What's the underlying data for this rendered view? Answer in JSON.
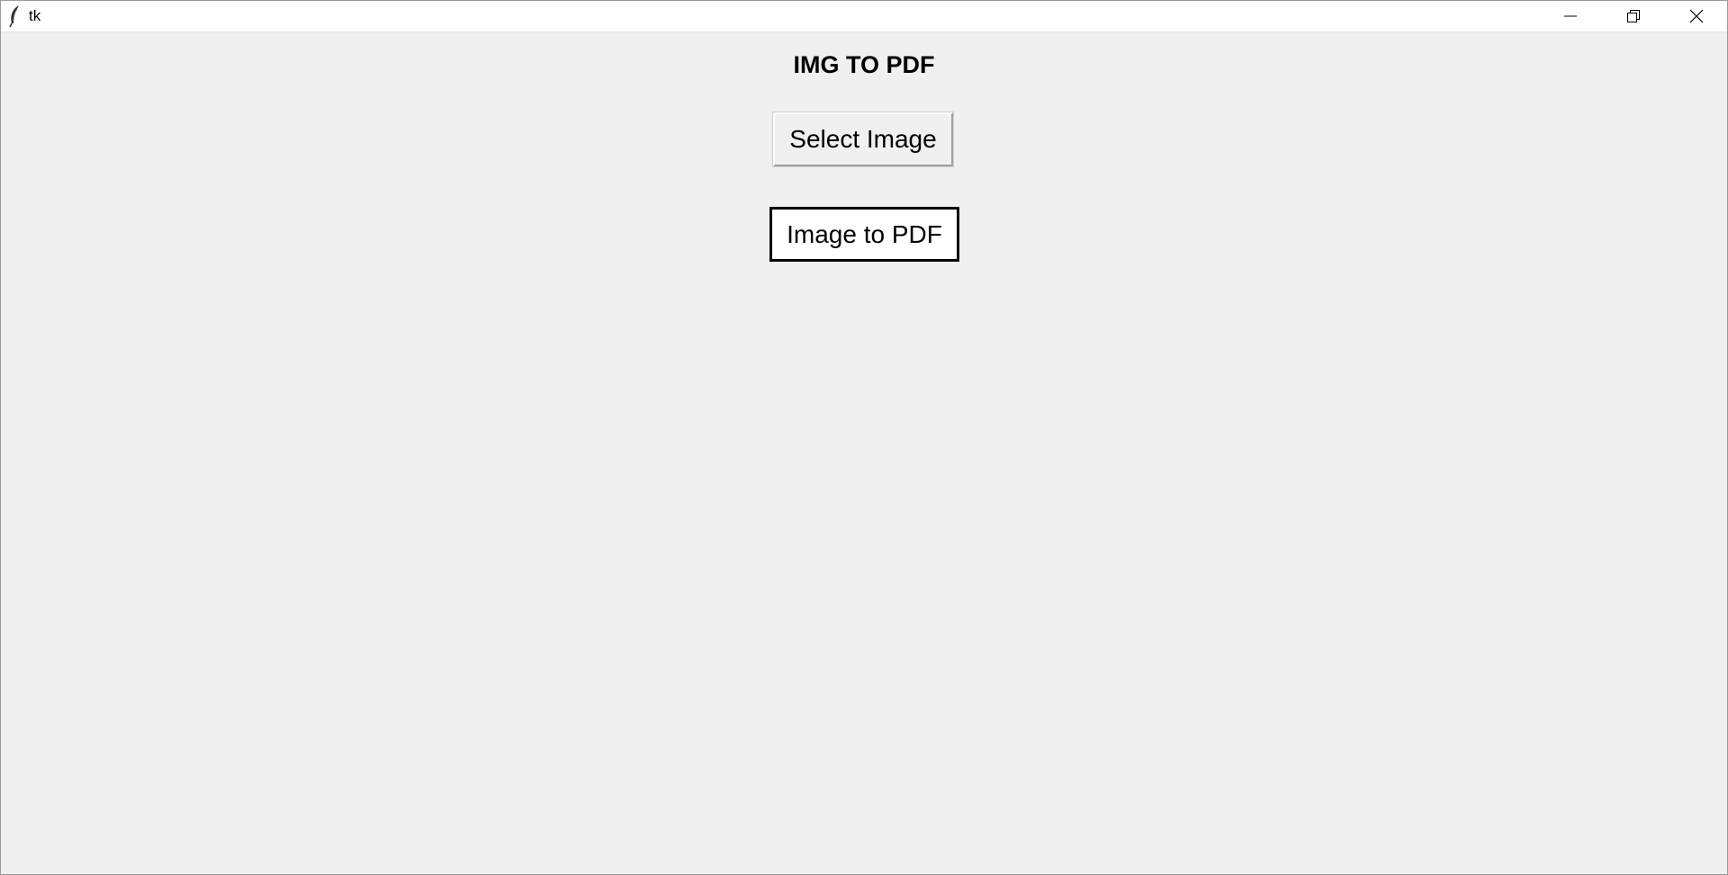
{
  "window": {
    "title": "tk",
    "app_icon": "tk-feather-icon",
    "controls": {
      "minimize_icon": "minimize-icon",
      "restore_icon": "restore-icon",
      "close_icon": "close-icon"
    }
  },
  "main": {
    "heading": "IMG TO PDF",
    "select_button_label": "Select Image",
    "convert_button_label": "Image to PDF"
  },
  "colors": {
    "background": "#f0f0f0",
    "titlebar": "#ffffff",
    "text": "#000000"
  }
}
